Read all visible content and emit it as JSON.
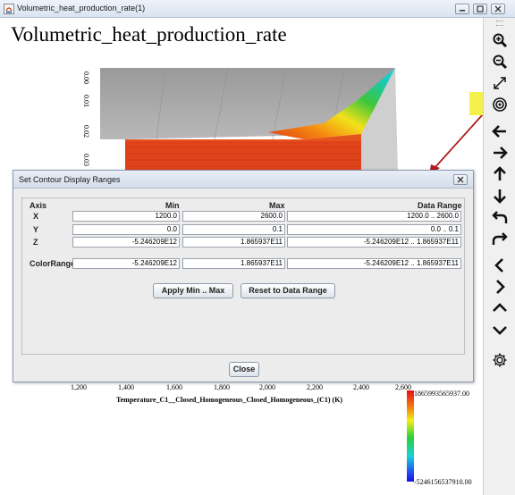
{
  "window": {
    "title": "Volumetric_heat_production_rate(1)"
  },
  "plot": {
    "title": "Volumetric_heat_production_rate",
    "axis_ticks": [
      "0.00",
      "0.01",
      "0.02",
      "0.03"
    ],
    "x_ticks": [
      "1,200",
      "1,400",
      "1,600",
      "1,800",
      "2,000",
      "2,200",
      "2,400",
      "2,600"
    ],
    "x_label": "Temperature_C1__Closed_Homogeneous_Closed_Homogeneous_(C1) (K)",
    "colorbar": {
      "max_label": "1865993565937.00",
      "min_label": "-5246156537910.00"
    },
    "colors": {
      "surface_red": "#e0421a",
      "backwall_gray": "#a8a8a8"
    }
  },
  "toolbar": {
    "items": [
      {
        "name": "zoom-in-icon"
      },
      {
        "name": "zoom-out-icon"
      },
      {
        "name": "fit-icon"
      },
      {
        "name": "contour-range-icon",
        "highlighted": true
      },
      {
        "name": "pan-left-icon"
      },
      {
        "name": "pan-right-icon"
      },
      {
        "name": "pan-up-icon"
      },
      {
        "name": "pan-down-icon"
      },
      {
        "name": "undo-icon"
      },
      {
        "name": "redo-icon"
      },
      {
        "name": "rotate-left-icon"
      },
      {
        "name": "rotate-right-icon"
      },
      {
        "name": "rotate-up-icon"
      },
      {
        "name": "rotate-down-icon"
      },
      {
        "name": "settings-icon"
      }
    ],
    "highlight_color": "#f4f24a"
  },
  "dialog": {
    "title": "Set Contour Display Ranges",
    "headers": {
      "axis": "Axis",
      "min": "Min",
      "max": "Max",
      "range": "Data Range"
    },
    "rows": [
      {
        "label": "X",
        "min": "1200.0",
        "max": "2600.0",
        "range": "1200.0 .. 2600.0"
      },
      {
        "label": "Y",
        "min": "0.0",
        "max": "0.1",
        "range": "0.0 .. 0.1"
      },
      {
        "label": "Z",
        "min": "-5.246209E12",
        "max": "1.865937E11",
        "range": "-5.246209E12 .. 1.865937E11"
      }
    ],
    "color_range": {
      "label": "ColorRange",
      "min": "-5.246209E12",
      "max": "1.865937E11",
      "range": "-5.246209E12 .. 1.865937E11"
    },
    "apply_label": "Apply Min .. Max",
    "reset_label": "Reset to Data Range",
    "close_label": "Close"
  }
}
